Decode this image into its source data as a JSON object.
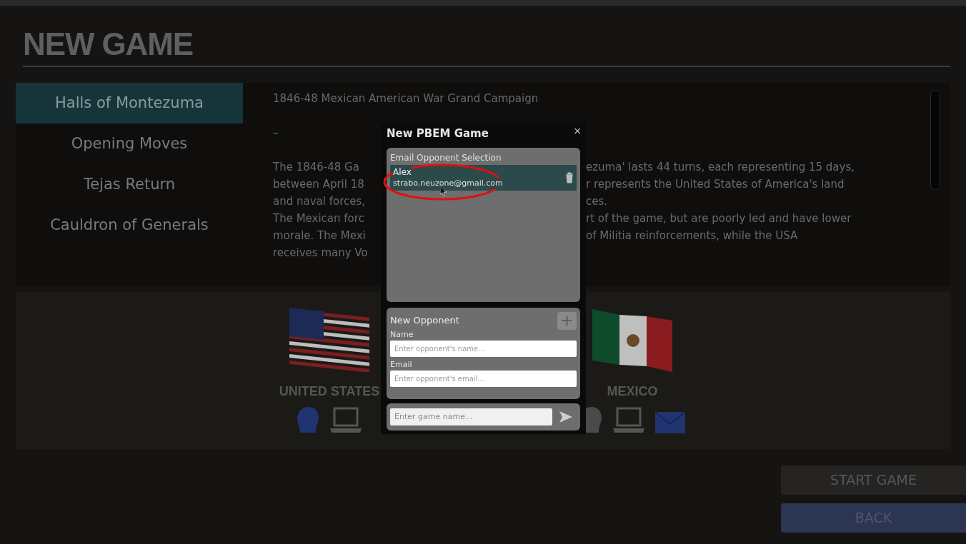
{
  "title": "NEW GAME",
  "scenarios": [
    {
      "label": "Halls of Montezuma",
      "selected": true
    },
    {
      "label": "Opening Moves",
      "selected": false
    },
    {
      "label": "Tejas Return",
      "selected": false
    },
    {
      "label": "Cauldron of Generals",
      "selected": false
    }
  ],
  "description": {
    "heading": "1846-48 Mexican American War Grand Campaign",
    "separator": "–",
    "lines": [
      {
        "left": "The 1846-48 Ga",
        "right": "ezuma' lasts 44 turns, each representing 15 days,"
      },
      {
        "left": "between April 18",
        "right": "r represents the United States of America's land"
      },
      {
        "left": "and naval forces,",
        "right": "ces."
      },
      {
        "left": "The Mexican forc",
        "right": "rt of the game, but are poorly led and have lower"
      },
      {
        "left": "morale. The Mexi",
        "right": "of Militia reinforcements, while the USA"
      },
      {
        "left": "receives many Vo"
      }
    ]
  },
  "sides": [
    {
      "name": "UNITED STATES",
      "kind": "usa",
      "controls": [
        {
          "kind": "human",
          "selected": true
        },
        {
          "kind": "computer",
          "selected": false
        }
      ]
    },
    {
      "name": "MEXICO",
      "kind": "mexico",
      "controls": [
        {
          "kind": "human",
          "selected": false
        },
        {
          "kind": "computer",
          "selected": false
        },
        {
          "kind": "email",
          "selected": true
        }
      ]
    }
  ],
  "buttons": [
    {
      "label": "START GAME",
      "kind": "secondary"
    },
    {
      "label": "BACK",
      "kind": "primary"
    }
  ],
  "dialog": {
    "title": "New PBEM Game",
    "close": "×",
    "selection": {
      "label": "Email Opponent Selection",
      "opponents": [
        {
          "name": "Alex",
          "email": "strabo.neuzone@gmail.com",
          "selected": true
        }
      ]
    },
    "new_opponent": {
      "label": "New Opponent",
      "add": "+",
      "name_label": "Name",
      "name_placeholder": "Enter opponent's name...",
      "email_label": "Email",
      "email_placeholder": "Enter opponent's email..."
    },
    "game_name_placeholder": "Enter game name..."
  }
}
